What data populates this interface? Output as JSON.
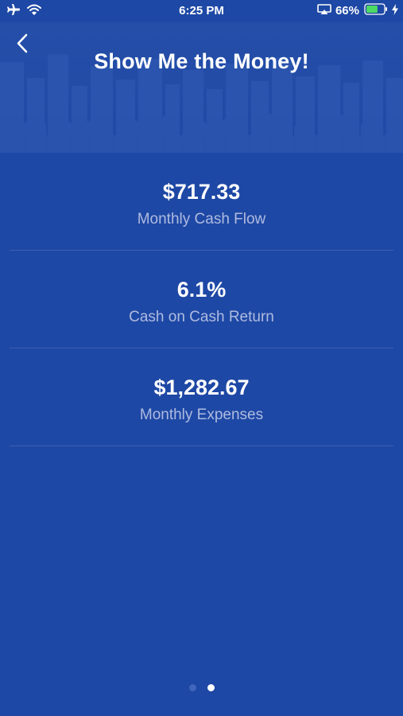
{
  "status_bar": {
    "time": "6:25 PM",
    "battery_percent": "66%",
    "battery_level": 0.66,
    "icons": [
      "airplane-icon",
      "wifi-icon",
      "screen-mirroring-icon",
      "battery-icon",
      "charging-bolt-icon"
    ]
  },
  "header": {
    "title": "Show Me the Money!",
    "back_icon": "chevron-left-icon"
  },
  "stats": [
    {
      "value": "$717.33",
      "label": "Monthly Cash Flow"
    },
    {
      "value": "6.1%",
      "label": "Cash on Cash Return"
    },
    {
      "value": "$1,282.67",
      "label": "Monthly Expenses"
    }
  ],
  "pagination": {
    "total": 2,
    "current": 2
  },
  "colors": {
    "background": "#1e48a5",
    "text": "#ffffff",
    "label": "#aebbe0",
    "battery_fill": "#4cd964"
  }
}
